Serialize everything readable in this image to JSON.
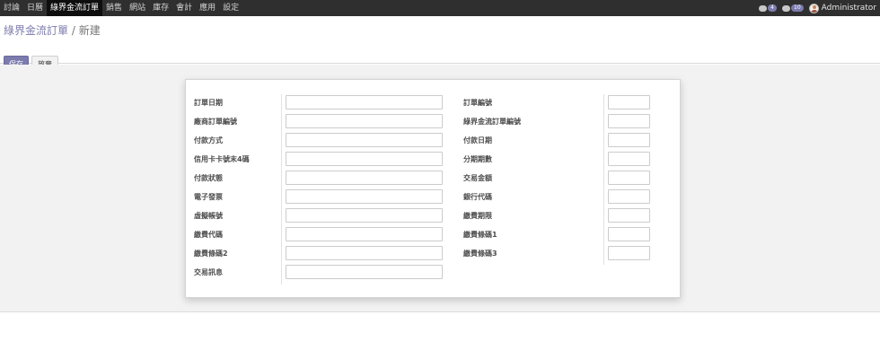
{
  "nav": {
    "menu": [
      "討論",
      "日曆",
      "綠界金流訂單",
      "銷售",
      "網站",
      "庫存",
      "會計",
      "應用",
      "設定"
    ],
    "active_index": 2,
    "notifications": [
      {
        "icon": "chat-bubble-icon",
        "count": "4"
      },
      {
        "icon": "message-icon",
        "count": "10"
      }
    ],
    "user": "Administrator"
  },
  "breadcrumb": {
    "parent": "綠界金流訂單",
    "separator": "/",
    "current": "新建"
  },
  "buttons": {
    "save": "保存",
    "discard": "放棄"
  },
  "form": {
    "left_fields": [
      {
        "label": "訂單日期",
        "value": ""
      },
      {
        "label": "廠商訂單編號",
        "value": ""
      },
      {
        "label": "付款方式",
        "value": ""
      },
      {
        "label": "信用卡卡號末4碼",
        "value": ""
      },
      {
        "label": "付款狀態",
        "value": ""
      },
      {
        "label": "電子發票",
        "value": ""
      },
      {
        "label": "虛擬帳號",
        "value": ""
      },
      {
        "label": "繳費代碼",
        "value": ""
      },
      {
        "label": "繳費條碼2",
        "value": ""
      },
      {
        "label": "交易訊息",
        "value": ""
      }
    ],
    "right_fields": [
      {
        "label": "訂單編號",
        "value": ""
      },
      {
        "label": "綠界金流訂單編號",
        "value": ""
      },
      {
        "label": "付款日期",
        "value": ""
      },
      {
        "label": "分期期數",
        "value": ""
      },
      {
        "label": "交易金額",
        "value": ""
      },
      {
        "label": "銀行代碼",
        "value": ""
      },
      {
        "label": "繳費期限",
        "value": ""
      },
      {
        "label": "繳費條碼1",
        "value": ""
      },
      {
        "label": "繳費條碼3",
        "value": ""
      }
    ]
  },
  "colors": {
    "accent": "#7c7bad",
    "navbar": "#2f2f2f",
    "navbar_active": "#0e0e0e",
    "form_bg": "#f2f2f2"
  }
}
